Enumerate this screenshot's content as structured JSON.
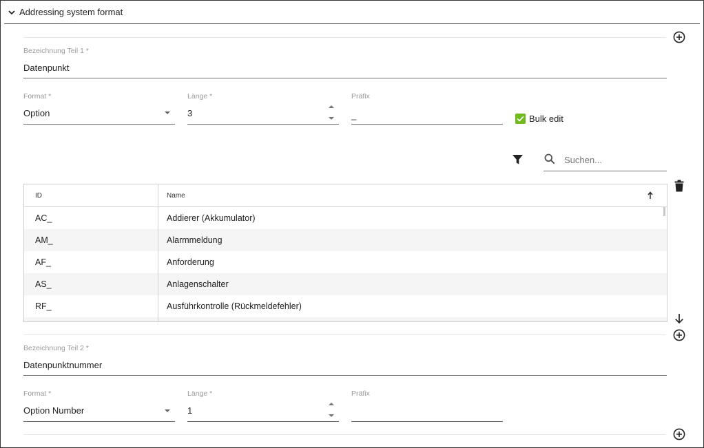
{
  "header": {
    "title": "Addressing system format"
  },
  "part1": {
    "bezeichnung_label": "Bezeichnung Teil 1 *",
    "bezeichnung_value": "Datenpunkt",
    "format_label": "Format *",
    "format_value": "Option",
    "laenge_label": "Länge *",
    "laenge_value": "3",
    "praefix_label": "Präfix",
    "praefix_value": "_",
    "bulk_edit_label": "Bulk edit",
    "bulk_edit_checked": true
  },
  "search": {
    "placeholder": "Suchen..."
  },
  "grid": {
    "columns": [
      "ID",
      "Name"
    ],
    "sort": "ascending",
    "rows": [
      {
        "id": "AC_",
        "name": "Addierer (Akkumulator)"
      },
      {
        "id": "AM_",
        "name": "Alarmmeldung"
      },
      {
        "id": "AF_",
        "name": "Anforderung"
      },
      {
        "id": "AS_",
        "name": "Anlagenschalter"
      },
      {
        "id": "RF_",
        "name": "Ausführkontrolle (Rückmeldefehler)"
      }
    ]
  },
  "part2": {
    "bezeichnung_label": "Bezeichnung Teil 2 *",
    "bezeichnung_value": "Datenpunktnummer",
    "format_label": "Format *",
    "format_value": "Option Number",
    "laenge_label": "Länge *",
    "laenge_value": "1",
    "praefix_label": "Präfix",
    "praefix_value": ""
  },
  "icons": {
    "expand": "chevron-down-icon",
    "add": "add-circle-icon",
    "filter": "filter-icon",
    "search": "search-icon",
    "delete": "trash-icon",
    "move_down": "arrow-down-icon",
    "sort": "arrow-up-icon"
  },
  "colors": {
    "checkbox": "#6fba1d"
  }
}
